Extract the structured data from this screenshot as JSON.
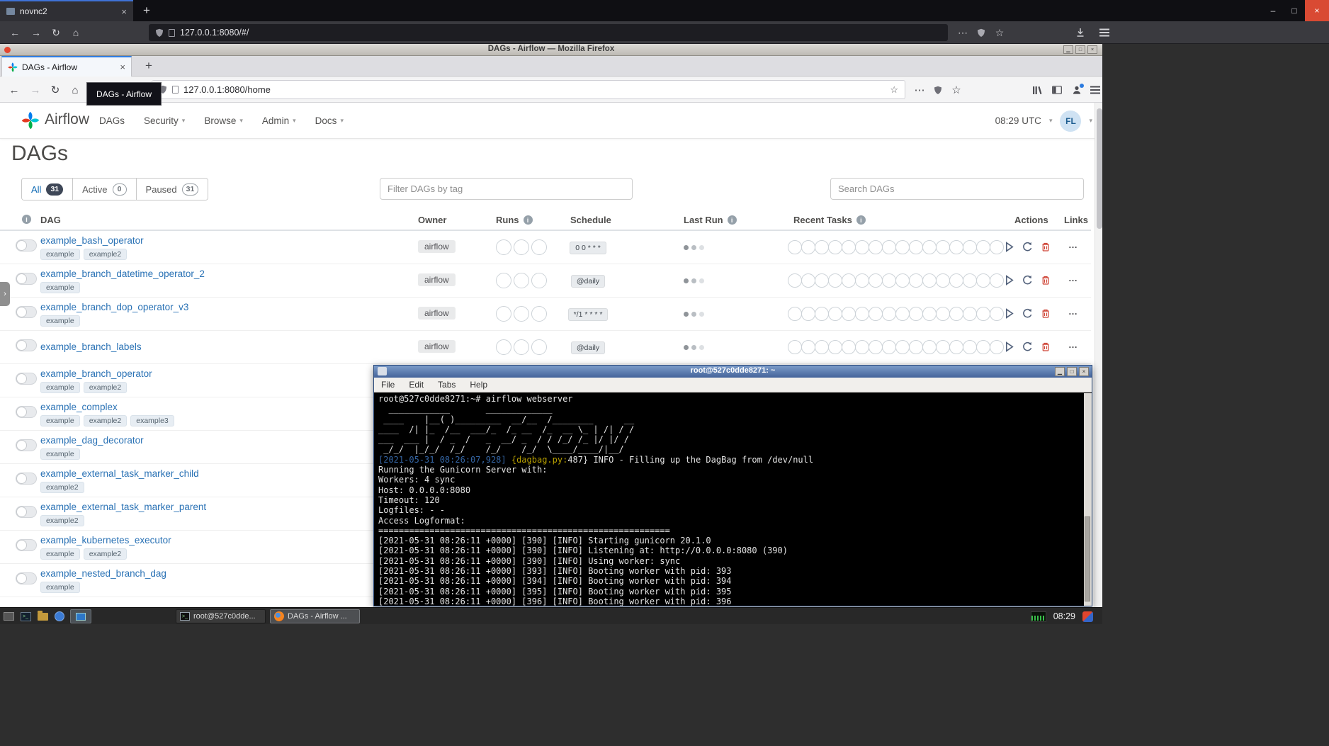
{
  "colors": {
    "airflow_blue": "#017CEE",
    "airflow_cyan": "#00C7D4",
    "airflow_green": "#00AD46",
    "airflow_red": "#E43921",
    "link_blue": "#2a72b5",
    "ansi_blue": "#3465a4",
    "ansi_yellow": "#b8a000"
  },
  "icons": {
    "back": "←",
    "forward": "→",
    "reload": "↻",
    "home": "⌂",
    "ellipsis": "⋯",
    "star": "☆",
    "close": "×",
    "plus": "+",
    "caret": "▾",
    "info": "i",
    "minimize": "–",
    "maximize": "□",
    "shade": "▁",
    "x": "×",
    "handle": "›",
    "links": "…",
    "terminal_prompt": ">_"
  },
  "outer_browser": {
    "tab_title": "novnc2",
    "url": "127.0.0.1:8080/#/"
  },
  "desktop": {
    "window_title": "DAGs - Airflow — Mozilla Firefox"
  },
  "inner_browser": {
    "tab_title": "DAGs - Airflow",
    "tooltip": "DAGs - Airflow",
    "url": "127.0.0.1:8080/home"
  },
  "airflow": {
    "brand": "Airflow",
    "nav": [
      {
        "label": "DAGs"
      },
      {
        "label": "Security",
        "caret": true
      },
      {
        "label": "Browse",
        "caret": true
      },
      {
        "label": "Admin",
        "caret": true
      },
      {
        "label": "Docs",
        "caret": true
      }
    ],
    "clock": "08:29 UTC",
    "avatar_initials": "FL",
    "page_title": "DAGs",
    "filter_tabs": [
      {
        "label": "All",
        "count": "31",
        "active": true
      },
      {
        "label": "Active",
        "count": "0"
      },
      {
        "label": "Paused",
        "count": "31"
      }
    ],
    "tag_filter_placeholder": "Filter DAGs by tag",
    "search_placeholder": "Search DAGs",
    "table": {
      "columns": [
        "DAG",
        "Owner",
        "Runs",
        "Schedule",
        "Last Run",
        "Recent Tasks",
        "Actions",
        "Links"
      ],
      "runs_slots": 3,
      "recent_slots": 16,
      "rows": [
        {
          "name": "example_bash_operator",
          "tags": [
            "example",
            "example2"
          ],
          "owner": "airflow",
          "schedule": "0 0 * * *",
          "full": true
        },
        {
          "name": "example_branch_datetime_operator_2",
          "tags": [
            "example"
          ],
          "owner": "airflow",
          "schedule": "@daily",
          "full": true
        },
        {
          "name": "example_branch_dop_operator_v3",
          "tags": [
            "example"
          ],
          "owner": "airflow",
          "schedule": "*/1 * * * *",
          "full": true
        },
        {
          "name": "example_branch_labels",
          "tags": [],
          "owner": "airflow",
          "schedule": "@daily",
          "full": true
        },
        {
          "name": "example_branch_operator",
          "tags": [
            "example",
            "example2"
          ],
          "full": false
        },
        {
          "name": "example_complex",
          "tags": [
            "example",
            "example2",
            "example3"
          ],
          "full": false
        },
        {
          "name": "example_dag_decorator",
          "tags": [
            "example"
          ],
          "full": false
        },
        {
          "name": "example_external_task_marker_child",
          "tags": [
            "example2"
          ],
          "full": false
        },
        {
          "name": "example_external_task_marker_parent",
          "tags": [
            "example2"
          ],
          "full": false
        },
        {
          "name": "example_kubernetes_executor",
          "tags": [
            "example",
            "example2"
          ],
          "full": false
        },
        {
          "name": "example_nested_branch_dag",
          "tags": [
            "example"
          ],
          "full": false
        }
      ]
    }
  },
  "terminal": {
    "title": "root@527c0dde8271: ~",
    "menu": [
      "File",
      "Edit",
      "Tabs",
      "Help"
    ],
    "lines": [
      [
        {
          "t": "root@527c0dde8271:~# airflow webserver"
        }
      ],
      [
        {
          "t": "  ____________       _____________"
        }
      ],
      [
        {
          "t": " ____    |__( )_________  __/__  /________      __"
        }
      ],
      [
        {
          "t": "____  /| |_  /__  ___/_  /_ __  /_  __ \\_ | /| / /"
        }
      ],
      [
        {
          "t": "___  ___ |  / _  /   _  __/ _  / / /_/ /_ |/ |/ /"
        }
      ],
      [
        {
          "t": " _/_/  |_/_/  /_/    /_/    /_/  \\____/____/|__/"
        }
      ],
      [
        {
          "t": "[2021-05-31 08:26:07,928] ",
          "c": "#3465a4"
        },
        {
          "t": "{dagbag.py:",
          "c": "#b8a000"
        },
        {
          "t": "487} INFO - Filling up the DagBag from /dev/null"
        }
      ],
      [
        {
          "t": "Running the Gunicorn Server with:"
        }
      ],
      [
        {
          "t": "Workers: 4 sync"
        }
      ],
      [
        {
          "t": "Host: 0.0.0.0:8080"
        }
      ],
      [
        {
          "t": "Timeout: 120"
        }
      ],
      [
        {
          "t": "Logfiles: - -"
        }
      ],
      [
        {
          "t": "Access Logformat: "
        }
      ],
      [
        {
          "t": "========================================================="
        }
      ],
      [
        {
          "t": "[2021-05-31 08:26:11 +0000] [390] [INFO] Starting gunicorn 20.1.0"
        }
      ],
      [
        {
          "t": "[2021-05-31 08:26:11 +0000] [390] [INFO] Listening at: http://0.0.0.0:8080 (390)"
        }
      ],
      [
        {
          "t": "[2021-05-31 08:26:11 +0000] [390] [INFO] Using worker: sync"
        }
      ],
      [
        {
          "t": "[2021-05-31 08:26:11 +0000] [393] [INFO] Booting worker with pid: 393"
        }
      ],
      [
        {
          "t": "[2021-05-31 08:26:11 +0000] [394] [INFO] Booting worker with pid: 394"
        }
      ],
      [
        {
          "t": "[2021-05-31 08:26:11 +0000] [395] [INFO] Booting worker with pid: 395"
        }
      ],
      [
        {
          "t": "[2021-05-31 08:26:11 +0000] [396] [INFO] Booting worker with pid: 396"
        }
      ]
    ]
  },
  "taskbar": {
    "window_buttons": [
      {
        "label": "root@527c0dde...",
        "icon": "terminal"
      },
      {
        "label": "DAGs - Airflow ...",
        "icon": "firefox",
        "active": true
      }
    ],
    "clock": "08:29"
  }
}
